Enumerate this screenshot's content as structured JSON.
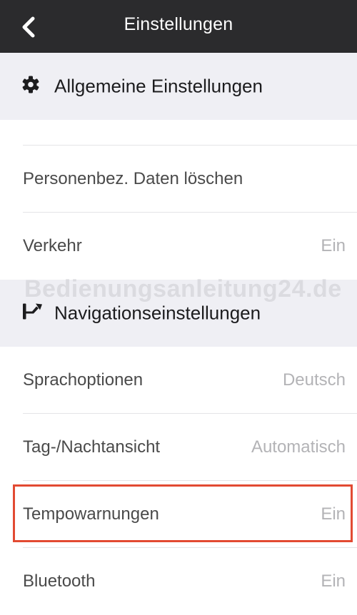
{
  "header": {
    "title": "Einstellungen"
  },
  "sections": {
    "general": {
      "label": "Allgemeine Einstellungen",
      "icon": "gear-icon"
    },
    "navigation": {
      "label": "Navigationseinstellungen",
      "icon": "route-fork-icon"
    }
  },
  "rows": {
    "delete_data": {
      "label": "Personenbez. Daten löschen",
      "value": ""
    },
    "traffic": {
      "label": "Verkehr",
      "value": "Ein"
    },
    "language": {
      "label": "Sprachoptionen",
      "value": "Deutsch"
    },
    "day_night": {
      "label": "Tag-/Nachtansicht",
      "value": "Automatisch"
    },
    "speed_warnings": {
      "label": "Tempowarnungen",
      "value": "Ein"
    },
    "bluetooth": {
      "label": "Bluetooth",
      "value": "Ein"
    }
  },
  "watermark": "Bedienungsanleitung24.de",
  "colors": {
    "header_bg": "#2b2b2d",
    "section_bg": "#efeff4",
    "highlight": "#e24a32"
  }
}
